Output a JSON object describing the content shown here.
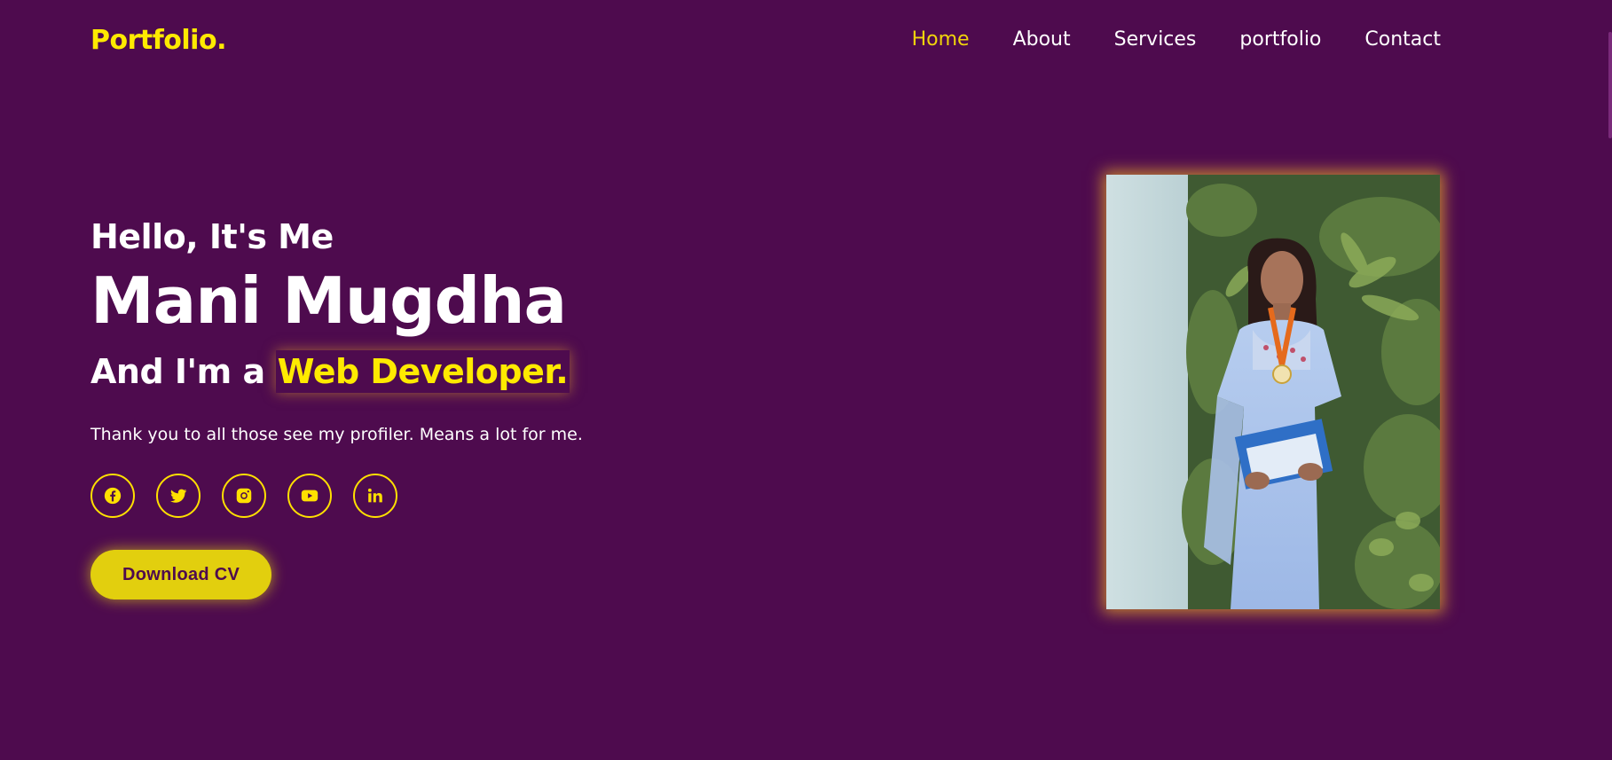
{
  "header": {
    "logo": "Portfolio.",
    "nav": [
      {
        "label": "Home",
        "active": true
      },
      {
        "label": "About",
        "active": false
      },
      {
        "label": "Services",
        "active": false
      },
      {
        "label": "portfolio",
        "active": false
      },
      {
        "label": "Contact",
        "active": false
      }
    ]
  },
  "hero": {
    "greeting": "Hello, It's Me",
    "name": "Mani Mugdha",
    "role_prefix": "And I'm a",
    "role_highlight": "Web Developer.",
    "tagline": "Thank you to all those see my profiler. Means a lot for me.",
    "socials": [
      "facebook-icon",
      "twitter-icon",
      "instagram-icon",
      "youtube-icon",
      "linkedin-icon"
    ],
    "cv_button": "Download CV"
  },
  "colors": {
    "background": "#4e0b4e",
    "accent": "#ffea00",
    "button": "#e2cf0e",
    "glow": "#e9aa28"
  }
}
